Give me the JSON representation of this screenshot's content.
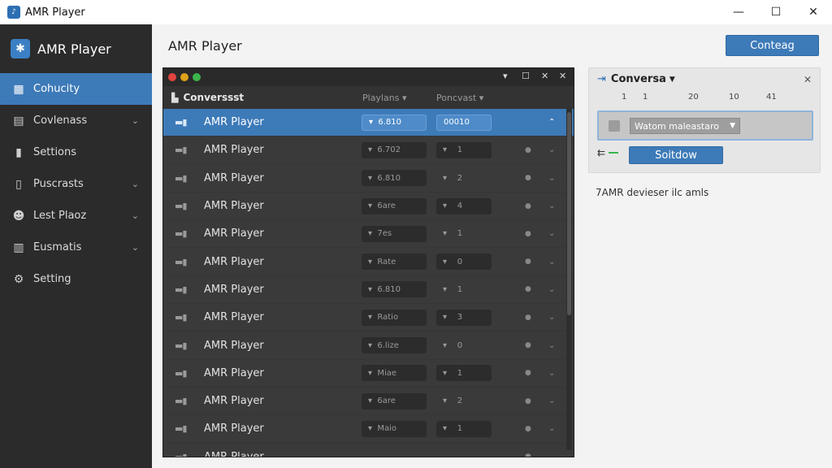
{
  "window": {
    "title": "AMR Player",
    "controls": {
      "minimize": "—",
      "maximize": "☐",
      "close": "✕"
    }
  },
  "sidebar": {
    "title": "AMR Player",
    "items": [
      {
        "label": "Cohucity",
        "icon": "grid-icon",
        "glyph": "▦",
        "active": true,
        "has_chevron": false
      },
      {
        "label": "Covlenass",
        "icon": "inbox-icon",
        "glyph": "▤",
        "active": false,
        "has_chevron": true
      },
      {
        "label": "Settions",
        "icon": "bar-chart-icon",
        "glyph": "▮",
        "active": false,
        "has_chevron": false
      },
      {
        "label": "Puscrasts",
        "icon": "document-icon",
        "glyph": "▯",
        "active": false,
        "has_chevron": true
      },
      {
        "label": "Lest Plaoz",
        "icon": "users-icon",
        "glyph": "☻",
        "active": false,
        "has_chevron": true
      },
      {
        "label": "Eusmatis",
        "icon": "building-icon",
        "glyph": "▥",
        "active": false,
        "has_chevron": true
      },
      {
        "label": "Setting",
        "icon": "gear-icon",
        "glyph": "⚙",
        "active": false,
        "has_chevron": false
      }
    ]
  },
  "main": {
    "title": "AMR Player",
    "top_button": "Conteag"
  },
  "panel": {
    "header": {
      "name": "Converssst",
      "col2": "Playlans",
      "col3": "Poncvast"
    },
    "rows": [
      {
        "name": "AMR Player",
        "v1": "6.810",
        "v2": "00010",
        "selected": true
      },
      {
        "name": "AMR Player",
        "v1": "6.702",
        "v2": "1",
        "selected": false
      },
      {
        "name": "AMR Player",
        "v1": "6.810",
        "v2": "2",
        "selected": false
      },
      {
        "name": "AMR Player",
        "v1": "6are",
        "v2": "4",
        "selected": false
      },
      {
        "name": "AMR Player",
        "v1": "7es",
        "v2": "1",
        "selected": false
      },
      {
        "name": "AMR Player",
        "v1": "Rate",
        "v2": "0",
        "selected": false
      },
      {
        "name": "AMR Player",
        "v1": "6.810",
        "v2": "1",
        "selected": false
      },
      {
        "name": "AMR Player",
        "v1": "Ratio",
        "v2": "3",
        "selected": false
      },
      {
        "name": "AMR Player",
        "v1": "6.lize",
        "v2": "0",
        "selected": false
      },
      {
        "name": "AMR Player",
        "v1": "Miae",
        "v2": "1",
        "selected": false
      },
      {
        "name": "AMR Player",
        "v1": "6are",
        "v2": "2",
        "selected": false
      },
      {
        "name": "AMR Player",
        "v1": "Maio",
        "v2": "1",
        "selected": false
      },
      {
        "name": "AMR Player",
        "v1": "",
        "v2": "",
        "selected": false
      }
    ]
  },
  "card": {
    "title": "Conversa",
    "ticks": [
      "1",
      "1",
      "20",
      "10",
      "41"
    ],
    "select_value": "Watom maleastaro",
    "button": "Soitdow",
    "arrows": "⇇"
  },
  "footer_text": "7AMR devieser ilc amls"
}
